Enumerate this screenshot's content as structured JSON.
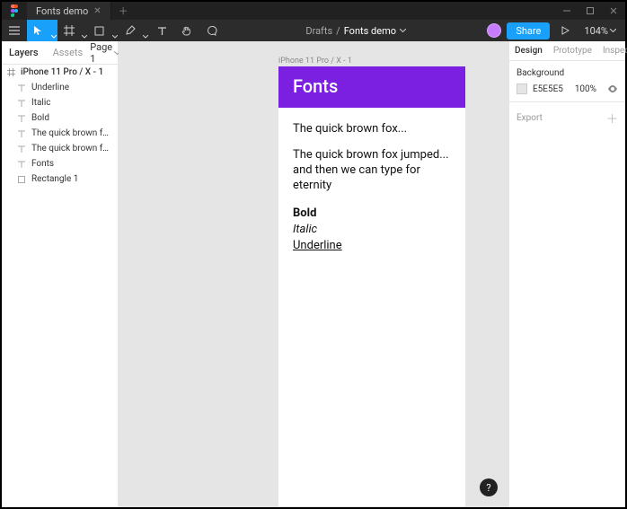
{
  "titlebar": {
    "tab_name": "Fonts demo"
  },
  "toolbar": {
    "breadcrumb_root": "Drafts",
    "breadcrumb_sep": "/",
    "breadcrumb_current": "Fonts demo",
    "share_label": "Share",
    "zoom": "104%"
  },
  "left": {
    "tab_layers": "Layers",
    "tab_assets": "Assets",
    "page_label": "Page 1",
    "frame": "iPhone 11 Pro / X - 1",
    "layers": [
      "Underline",
      "Italic",
      "Bold",
      "The quick brown fox jumped......",
      "The quick brown fox...",
      "Fonts",
      "Rectangle 1"
    ]
  },
  "canvas": {
    "frame_label": "iPhone 11 Pro / X - 1",
    "header": "Fonts",
    "line1": "The quick brown fox...",
    "para": "The quick brown fox jumped... and then we can type for eternity",
    "bold": "Bold",
    "italic": "Italic",
    "underline": "Underline"
  },
  "right": {
    "tab_design": "Design",
    "tab_proto": "Prototype",
    "tab_inspect": "Inspect",
    "bg_title": "Background",
    "bg_hex": "E5E5E5",
    "bg_opacity": "100%",
    "export_title": "Export"
  }
}
